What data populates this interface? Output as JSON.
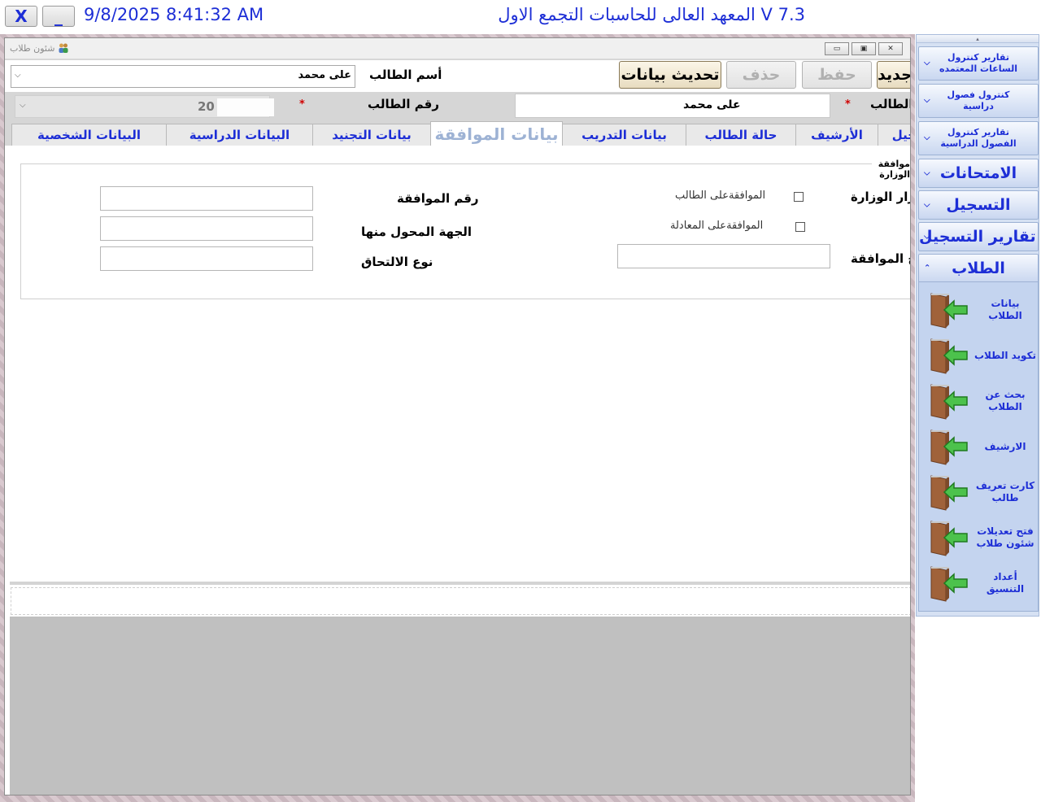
{
  "topbar": {
    "close_label": "X",
    "minimize_label": "_",
    "clock": "9/8/2025 8:41:32 AM",
    "app_title": "V 7.3 المعهد العالى للحاسبات التجمع الاول"
  },
  "window": {
    "caption": "شئون طلاب",
    "controls": {
      "minimize": "▭",
      "maximize": "▣",
      "close": "✕"
    }
  },
  "header": {
    "student_name_label": "أسم الطالب",
    "student_name_value": "على محمد",
    "buttons": {
      "refresh": "تحديث بيانات",
      "delete": "حذف",
      "save": "حفظ",
      "new": "جديد"
    }
  },
  "strip": {
    "student_number_label": "رقم الطالب",
    "student_number_value": "20",
    "required_mark": "*",
    "name_field_value": "على محمد",
    "name_label_cut": "الطالب"
  },
  "tabs": [
    {
      "label": "البيانات الشخصية",
      "active": false
    },
    {
      "label": "البيانات الدراسية",
      "active": false
    },
    {
      "label": "بيانات التجنيد",
      "active": false
    },
    {
      "label": "بيانات الموافقة",
      "active": true
    },
    {
      "label": "بيانات التدريب",
      "active": false
    },
    {
      "label": "حالة الطالب",
      "active": false
    },
    {
      "label": "الأرشيف",
      "active": false
    },
    {
      "label": "تسجيل",
      "active": false
    }
  ],
  "approval": {
    "group_caption": "موافقة الوزارة",
    "approval_number_label": "رقم الموافقة",
    "transferred_from_label": "الجهة المحول منها",
    "enrollment_type_label": "نوع الالتحاق",
    "ministry_decision_label": "قرار الوزارة",
    "approval_date_label": "تاريخ الموافقة",
    "student_approval_label": "الموافقةعلى الطالب",
    "equivalence_approval_label": "الموافقةعلى المعادلة",
    "approval_number_value": "",
    "transferred_from_value": "",
    "enrollment_type_value": "",
    "approval_date_value": ""
  },
  "sidebar": {
    "menus": [
      {
        "label": "تقارير كنترول الساعات المعتمده",
        "size": "small"
      },
      {
        "label": "كنترول فصول دراسية",
        "size": "small"
      },
      {
        "label": "تقارير كنترول الفصول الدراسية",
        "size": "small"
      },
      {
        "label": "الامتحانات",
        "size": "big"
      },
      {
        "label": "التسجيل",
        "size": "big"
      },
      {
        "label": "تقارير التسجيل",
        "size": "big"
      },
      {
        "label": "الطلاب",
        "size": "big"
      }
    ],
    "student_items": [
      {
        "label": "بيانات الطلاب",
        "icon": "door-arrow-icon"
      },
      {
        "label": "تكويد الطلاب",
        "icon": "door-arrow-icon"
      },
      {
        "label": "بحث عن الطلاب",
        "icon": "door-arrow-icon"
      },
      {
        "label": "الارشيف",
        "icon": "door-arrow-icon"
      },
      {
        "label": "كارت تعريف طالب",
        "icon": "door-arrow-icon"
      },
      {
        "label": "فتح تعديلات شئون طلاب",
        "icon": "door-arrow-icon"
      },
      {
        "label": "أعداد التنسيق",
        "icon": "door-arrow-icon"
      }
    ]
  },
  "colors": {
    "accent_blue": "#1d2ed6",
    "sidebar_bg": "#d6e1f3",
    "active_tab_text": "#9db2d4",
    "required_red": "#d00000"
  }
}
